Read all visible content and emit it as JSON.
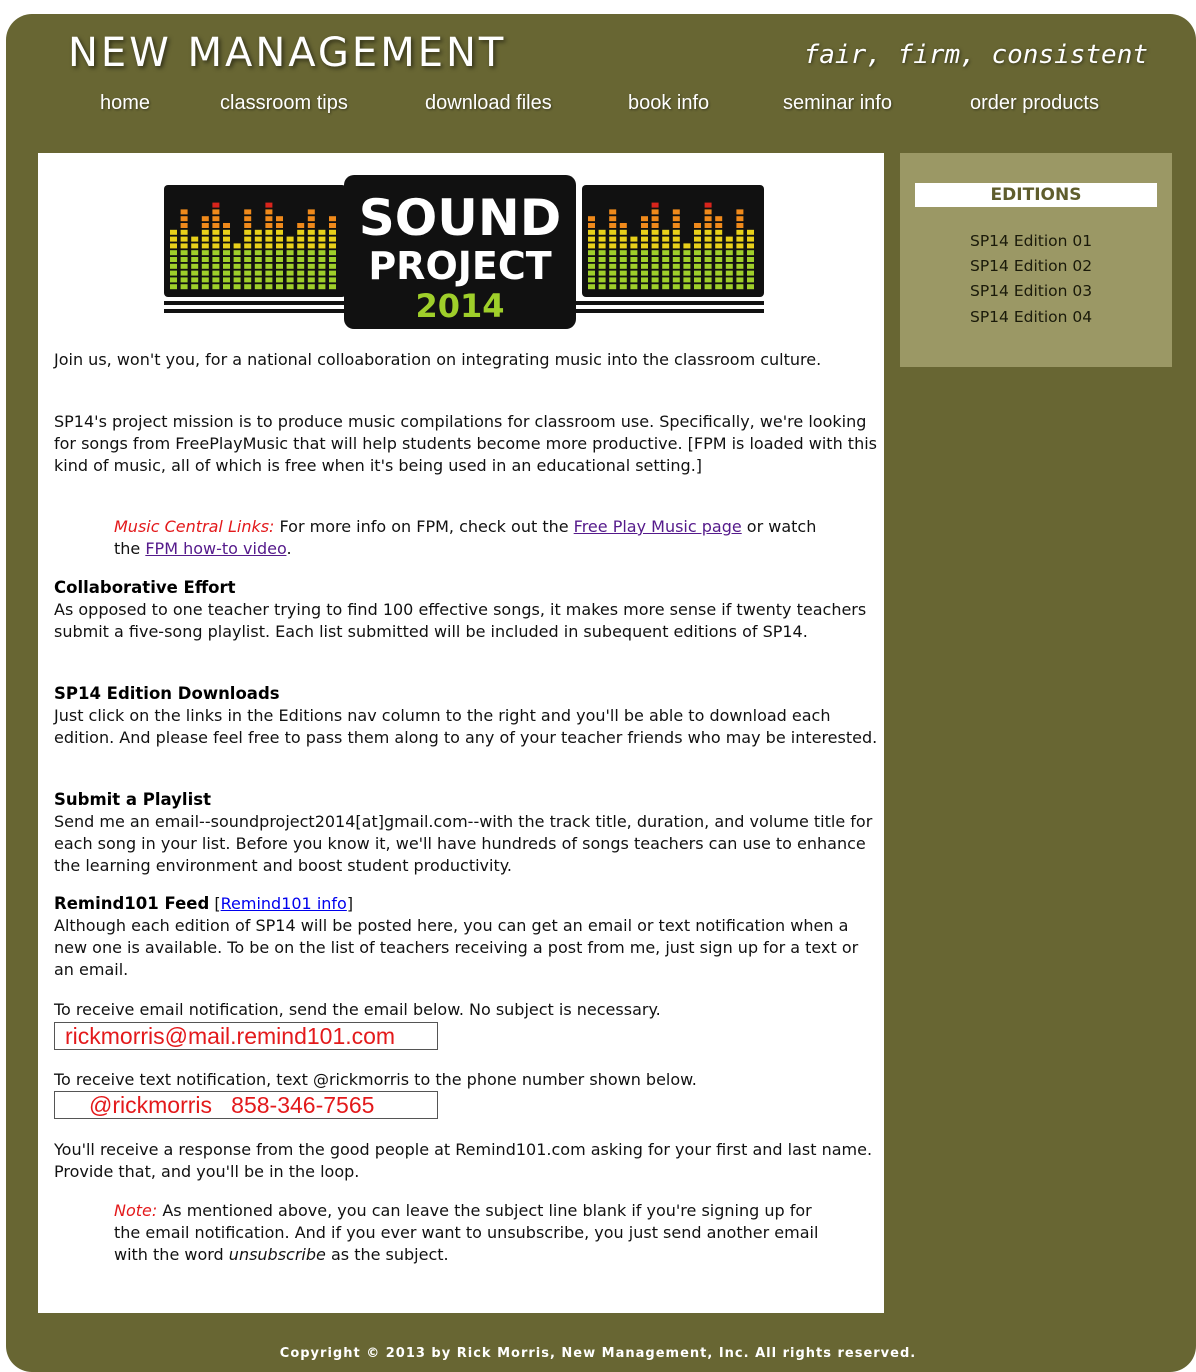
{
  "header": {
    "brand": "NEW MANAGEMENT",
    "tagline": "fair, firm, consistent"
  },
  "nav": {
    "items": [
      {
        "label": "home"
      },
      {
        "label": "classroom tips"
      },
      {
        "label": "download files"
      },
      {
        "label": "book info"
      },
      {
        "label": "seminar info"
      },
      {
        "label": "order products"
      }
    ]
  },
  "logo": {
    "line1": "SOUND",
    "line2": "PROJECT",
    "line3": "2014",
    "colors": {
      "bg": "#111111",
      "green": "#9fcf2a",
      "yellow": "#e8d01a",
      "orange": "#f08a1b",
      "red": "#d8241c"
    }
  },
  "sidebar": {
    "heading": "EDITIONS",
    "items": [
      {
        "label": "SP14 Edition 01"
      },
      {
        "label": "SP14 Edition 02"
      },
      {
        "label": "SP14 Edition 03"
      },
      {
        "label": "SP14 Edition 04"
      }
    ]
  },
  "content": {
    "intro": "Join us, won't you, for a national colloaboration on integrating music into the classroom culture.",
    "mission": "SP14's project mission is to produce music compilations for classroom use. Specifically, we're looking for songs from FreePlayMusic that will help students become more productive. [FPM is loaded with this kind of music, all of which is free when it's being used in an educational setting.]",
    "music_central": {
      "label": "Music Central Links:",
      "text_a": " For more info on FPM, check out the ",
      "link1": "Free Play Music page",
      "text_b": " or watch the ",
      "link2": "FPM how-to video",
      "text_c": "."
    },
    "collab": {
      "heading": "Collaborative Effort",
      "body": "As opposed to one teacher trying to find 100 effective songs, it makes more sense if twenty teachers submit a five-song playlist. Each list submitted will be included in subequent editions of SP14."
    },
    "downloads": {
      "heading": "SP14 Edition Downloads",
      "body": "Just click on the links in the Editions nav column to the right and you'll be able to download each edition. And please feel free to pass them along to any of your teacher friends who may be interested."
    },
    "submit": {
      "heading": "Submit a Playlist",
      "body": "Send me an email--soundproject2014[at]gmail.com--with the track title, duration, and volume title for each song in your list. Before you know it, we'll have hundreds of songs teachers can use to enhance the learning environment and boost student productivity."
    },
    "remind": {
      "heading": "Remind101 Feed",
      "bracket_open": " [",
      "link": "Remind101 info",
      "bracket_close": "]",
      "body": "Although each edition of SP14 will be posted here, you can get an email or text notification when a new one is available. To be on the list of teachers receiving a post from me, just sign up for a text or an email."
    },
    "email_instr": "To receive email notification, send the email below. No subject is necessary.",
    "email_box": "rickmorris@mail.remind101.com",
    "text_instr": "To receive text notification, text @rickmorris to the phone number shown below.",
    "text_box": "@rickmorris   858-346-7565",
    "response": "You'll receive a response from the good people at Remind101.com asking for your first and last name. Provide that, and you'll be in the loop.",
    "note": {
      "label": "Note:",
      "text_a": " As mentioned above, you can leave the subject line blank if you're signing up for the email notification. And if you ever want to unsubscribe, you just send another email with the word ",
      "emph": "unsubscribe",
      "text_b": " as the subject."
    }
  },
  "footer": {
    "copyright": "Copyright © 2013 by Rick Morris, New Management, Inc.  All rights reserved."
  }
}
